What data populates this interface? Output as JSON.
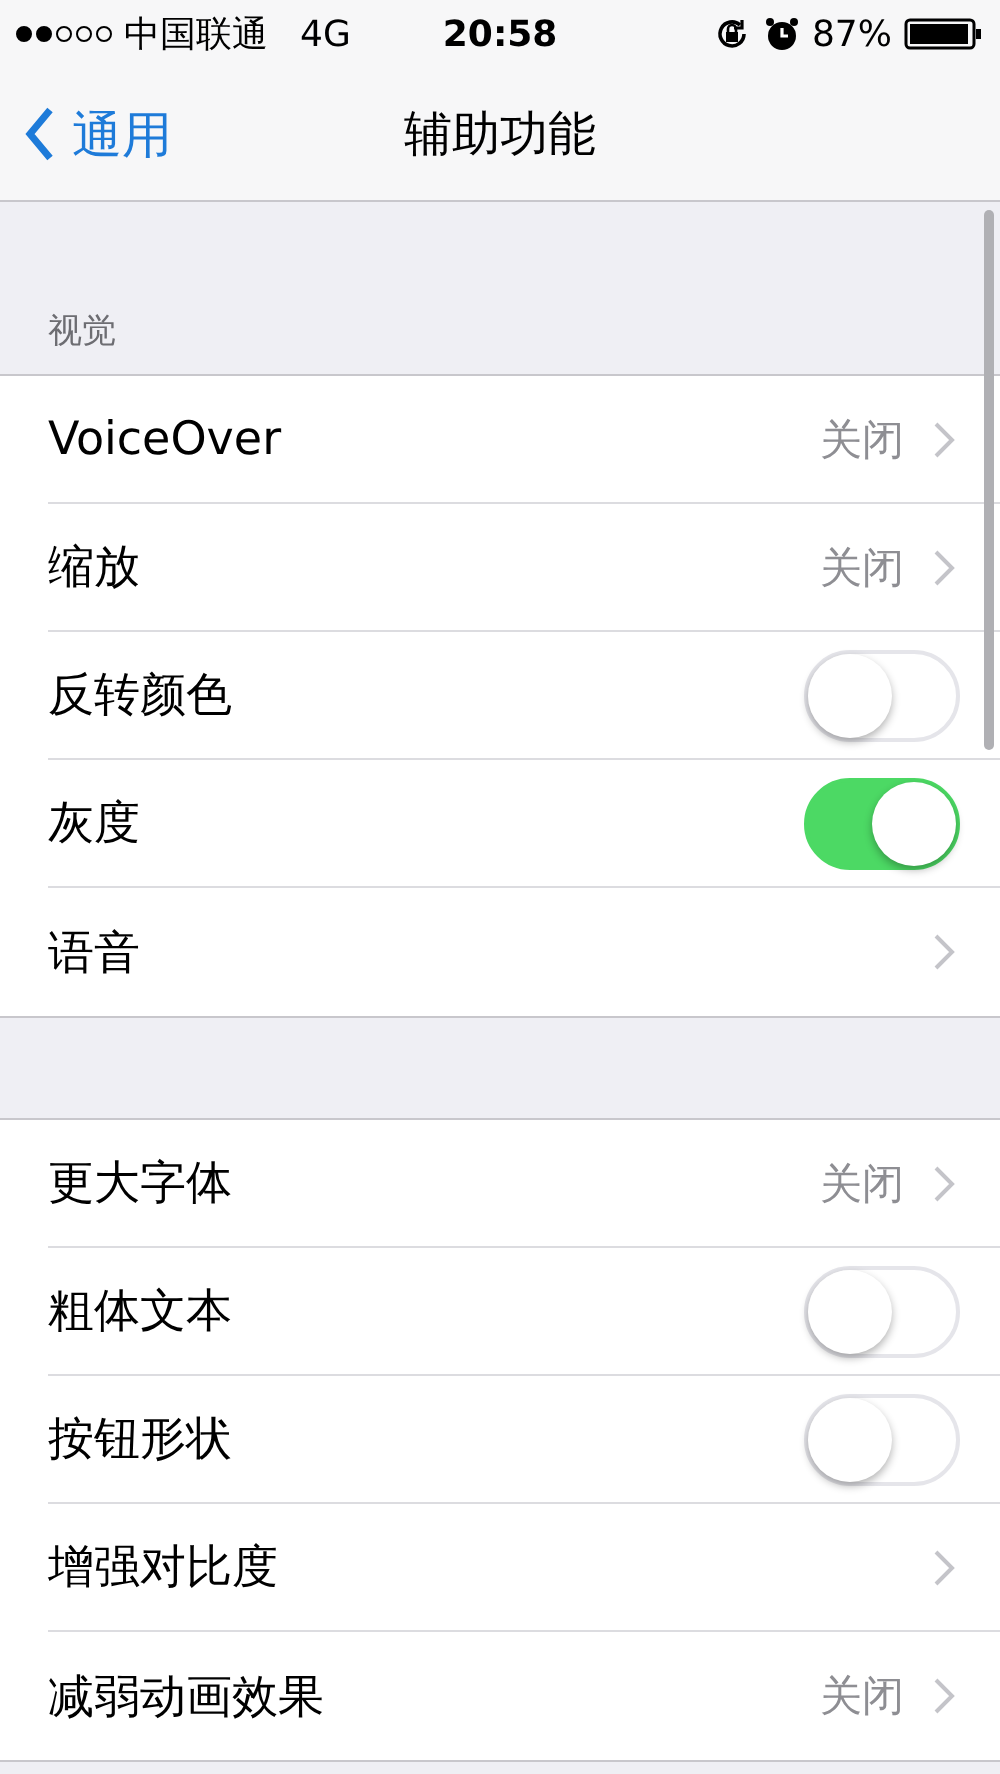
{
  "status_bar": {
    "carrier": "中国联通",
    "network": "4G",
    "time": "20:58",
    "battery": "87%"
  },
  "nav": {
    "back": "通用",
    "title": "辅助功能"
  },
  "sections": [
    {
      "header": "视觉",
      "rows": [
        {
          "kind": "link",
          "label": "VoiceOver",
          "value": "关闭"
        },
        {
          "kind": "link",
          "label": "缩放",
          "value": "关闭"
        },
        {
          "kind": "toggle",
          "label": "反转颜色",
          "on": false
        },
        {
          "kind": "toggle",
          "label": "灰度",
          "on": true
        },
        {
          "kind": "link",
          "label": "语音"
        }
      ]
    },
    {
      "rows": [
        {
          "kind": "link",
          "label": "更大字体",
          "value": "关闭"
        },
        {
          "kind": "toggle",
          "label": "粗体文本",
          "on": false
        },
        {
          "kind": "toggle",
          "label": "按钮形状",
          "on": false
        },
        {
          "kind": "link",
          "label": "增强对比度"
        },
        {
          "kind": "link",
          "label": "减弱动画效果",
          "value": "关闭"
        }
      ]
    }
  ]
}
